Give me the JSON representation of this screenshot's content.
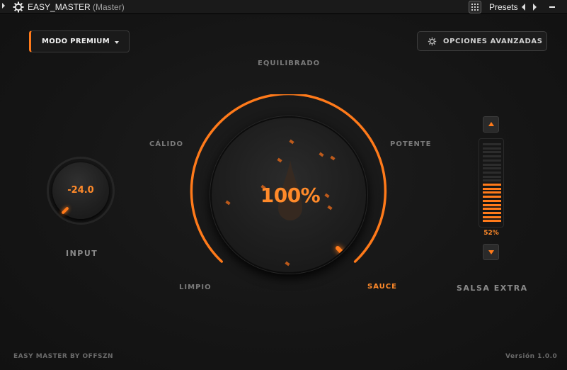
{
  "titlebar": {
    "app_name": "EASY_MASTER",
    "track": "(Master)",
    "presets_label": "Presets"
  },
  "plugin": {
    "mode_label": "MODO PREMIUM",
    "advanced_label": "OPCIONES AVANZADAS",
    "tone_labels": {
      "top": "EQUILIBRADO",
      "left": "CÁLIDO",
      "right": "POTENTE",
      "bottom_left": "LIMPIO",
      "bottom_right": "SAUCE"
    },
    "input": {
      "value": "-24.0",
      "label": "INPUT"
    },
    "main_dial": {
      "value": "100%",
      "level": 1.0
    },
    "salsa": {
      "label": "SALSA EXTRA",
      "value": "52%",
      "level": 0.52
    },
    "footer": {
      "left": "EASY MASTER BY OFFSZN",
      "right": "Versión 1.0.0"
    }
  },
  "colors": {
    "accent": "#ff7a1a",
    "background": "#141414",
    "inactive_text": "#7a7a7a"
  },
  "icons": [
    "gear-icon",
    "preset-grid-icon",
    "chevron-left-icon",
    "chevron-right-icon",
    "minimize-icon",
    "settings-icon",
    "caret-down-icon",
    "flame-drop-icon",
    "arrow-up-icon",
    "arrow-down-icon"
  ]
}
